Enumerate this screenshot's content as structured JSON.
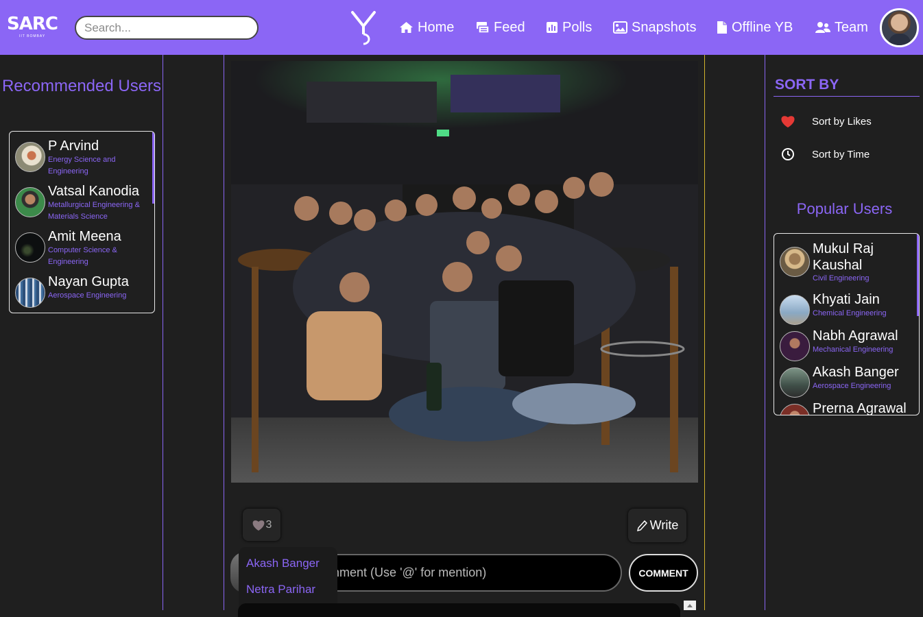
{
  "navbar": {
    "logo_text": "SARC",
    "logo_sub": "IIT BOMBAY",
    "search_placeholder": "Search...",
    "yb_logo_icon": "yearbook-logo-icon",
    "items": [
      {
        "label": "Home",
        "icon": "home-icon"
      },
      {
        "label": "Feed",
        "icon": "feed-icon"
      },
      {
        "label": "Polls",
        "icon": "polls-icon"
      },
      {
        "label": "Snapshots",
        "icon": "image-icon"
      },
      {
        "label": "Offline YB",
        "icon": "file-icon"
      },
      {
        "label": "Team",
        "icon": "team-icon"
      }
    ],
    "background": "#8b66f5"
  },
  "left_sidebar": {
    "title": "Recommended Users",
    "users": [
      {
        "name": "P Arvind",
        "department": "Energy Science and Engineering"
      },
      {
        "name": "Vatsal Kanodia",
        "department": "Metallurgical Engineering & Materials Science"
      },
      {
        "name": "Amit Meena",
        "department": "Computer Science & Engineering"
      },
      {
        "name": "Nayan Gupta",
        "department": "Aerospace Engineering"
      }
    ]
  },
  "post": {
    "like_count": "3",
    "write_label": "Write",
    "comment_placeholder": "Add a Comment (Use '@' for mention)",
    "comment_button": "COMMENT",
    "mention_suggestions": [
      "Akash Banger",
      "Netra Parihar"
    ]
  },
  "right_sidebar": {
    "sort_title": "SORT BY",
    "sort_options": [
      {
        "label": "Sort by Likes",
        "icon": "heart-icon"
      },
      {
        "label": "Sort by Time",
        "icon": "clock-icon"
      }
    ],
    "popular_title": "Popular Users",
    "popular_users": [
      {
        "name": "Mukul Raj Kaushal",
        "department": "Civil Engineering"
      },
      {
        "name": "Khyati Jain",
        "department": "Chemical Engineering"
      },
      {
        "name": "Nabh Agrawal",
        "department": "Mechanical Engineering"
      },
      {
        "name": "Akash Banger",
        "department": "Aerospace Engineering"
      },
      {
        "name": "Prerna Agrawal",
        "department": ""
      }
    ]
  },
  "colors": {
    "accent": "#8b66f5",
    "background": "#1f1f1f",
    "heart": "#e53935"
  }
}
